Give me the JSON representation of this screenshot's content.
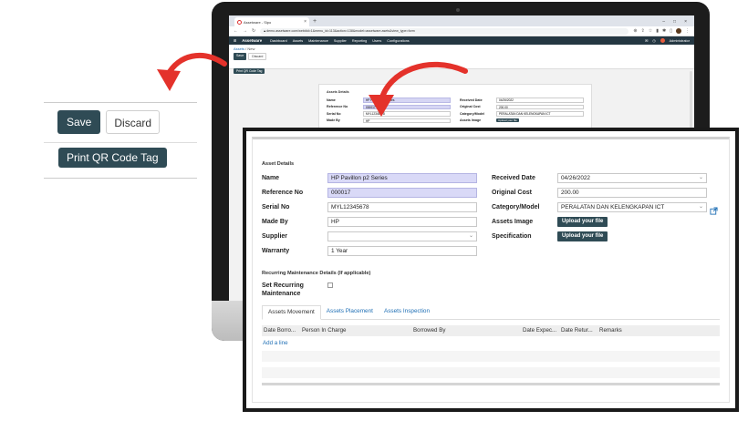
{
  "browser": {
    "tab_title": "Assetware - Sipo",
    "new_tab": "+",
    "url": "demo.assetware.com/web#id=1&menu_id=113&action=138&model=assetware.asets&view_type=form",
    "window_controls": [
      "–",
      "□",
      "×"
    ]
  },
  "app": {
    "brand": "Assetware",
    "menu": [
      "Dashboard",
      "Assets",
      "Maintenance",
      "Supplier",
      "Reporting",
      "Users",
      "Configurations"
    ],
    "user": "Administrator"
  },
  "breadcrumb": {
    "parent": "Assets",
    "separator": " / ",
    "current": "New"
  },
  "actions": {
    "save": "Save",
    "discard": "Discard",
    "print_qr": "Print QR Code Tag"
  },
  "mini_form": {
    "section": "Assets Details",
    "left": [
      {
        "label": "Name",
        "value": "HP Pavillion p2 Series"
      },
      {
        "label": "Reference No",
        "value": "000017"
      },
      {
        "label": "Serial No",
        "value": "MYL12345678"
      },
      {
        "label": "Made By",
        "value": "HP"
      }
    ],
    "right": [
      {
        "label": "Received Date",
        "value": "04/26/2022"
      },
      {
        "label": "Original Cost",
        "value": "200.00"
      },
      {
        "label": "Category/Model",
        "value": "PERALATAN DAN KELENGKAPAN ICT"
      },
      {
        "label": "Assets Image",
        "value": "Upload your file"
      }
    ]
  },
  "form": {
    "section_title": "Asset Details",
    "name_label": "Name",
    "name_value": "HP Pavillon p2 Series",
    "ref_label": "Reference No",
    "ref_value": "000017",
    "serial_label": "Serial No",
    "serial_value": "MYL12345678",
    "made_label": "Made By",
    "made_value": "HP",
    "supplier_label": "Supplier",
    "supplier_value": "",
    "warranty_label": "Warranty",
    "warranty_value": "1 Year",
    "received_label": "Received Date",
    "received_value": "04/26/2022",
    "cost_label": "Original Cost",
    "cost_value": "200.00",
    "category_label": "Category/Model",
    "category_value": "PERALATAN DAN KELENGKAPAN ICT",
    "image_label": "Assets Image",
    "image_button": "Upload your file",
    "spec_label": "Specification",
    "spec_button": "Upload your file",
    "recurring_section": "Recurring Maintenance Details (If applicable)",
    "recurring_label_1": "Set Recurring",
    "recurring_label_2": "Maintenance",
    "recurring_checked": false
  },
  "tabs": [
    "Assets Movement",
    "Assets Placement",
    "Assets Inspection"
  ],
  "table": {
    "columns": [
      "Date Borro...",
      "Person In Charge",
      "Borrowed By",
      "Date Expec...",
      "Date Retur...",
      "Remarks"
    ],
    "add_line": "Add a line"
  },
  "colors": {
    "primary_button": "#2f4b55",
    "navbar": "#243742",
    "required_field": "#d9d9f7",
    "link": "#1f6fb5",
    "arrow": "#e4322b"
  },
  "icons": [
    "chrome-icon",
    "back-arrow-icon",
    "forward-arrow-icon",
    "reload-icon",
    "lock-icon",
    "grid-apps-icon",
    "external-link-icon",
    "dropdown-caret-icon"
  ]
}
